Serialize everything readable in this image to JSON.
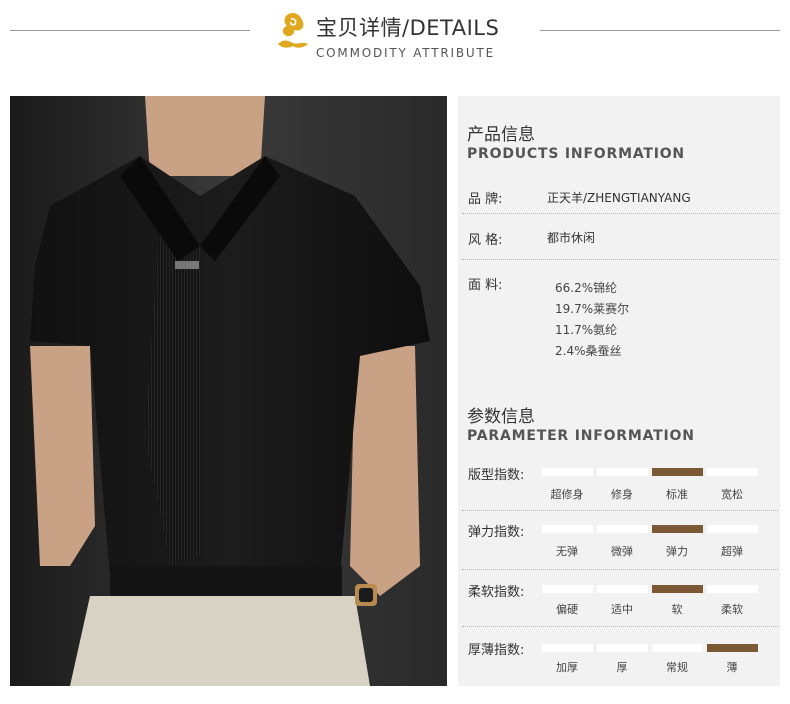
{
  "header": {
    "title": "宝贝详情/DETAILS",
    "subtitle": "COMMODITY ATTRIBUTE"
  },
  "colors": {
    "accent": "#7c5834",
    "logo_gold": "#e0a81e",
    "panel_bg": "#f2f2f2"
  },
  "products": {
    "title_cn": "产品信息",
    "title_en": "PRODUCTS INFORMATION",
    "brand_label": "品  牌:",
    "brand_value": "正天羊/ZHENGTIANYANG",
    "style_label": "风  格:",
    "style_value": "都市休闲",
    "fabric_label": "面  料:",
    "fabric": [
      "66.2%锦纶",
      "19.7%莱赛尔",
      "11.7%氨纶",
      "2.4%桑蚕丝"
    ]
  },
  "parameters": {
    "title_cn": "参数信息",
    "title_en": "PARAMETER INFORMATION",
    "rows": [
      {
        "label": "版型指数:",
        "options": [
          "超修身",
          "修身",
          "标准",
          "宽松"
        ],
        "selected": 2
      },
      {
        "label": "弹力指数:",
        "options": [
          "无弹",
          "微弹",
          "弹力",
          "超弹"
        ],
        "selected": 2
      },
      {
        "label": "柔软指数:",
        "options": [
          "偏硬",
          "适中",
          "软",
          "柔软"
        ],
        "selected": 2
      },
      {
        "label": "厚薄指数:",
        "options": [
          "加厚",
          "厚",
          "常规",
          "薄"
        ],
        "selected": 3
      }
    ]
  }
}
